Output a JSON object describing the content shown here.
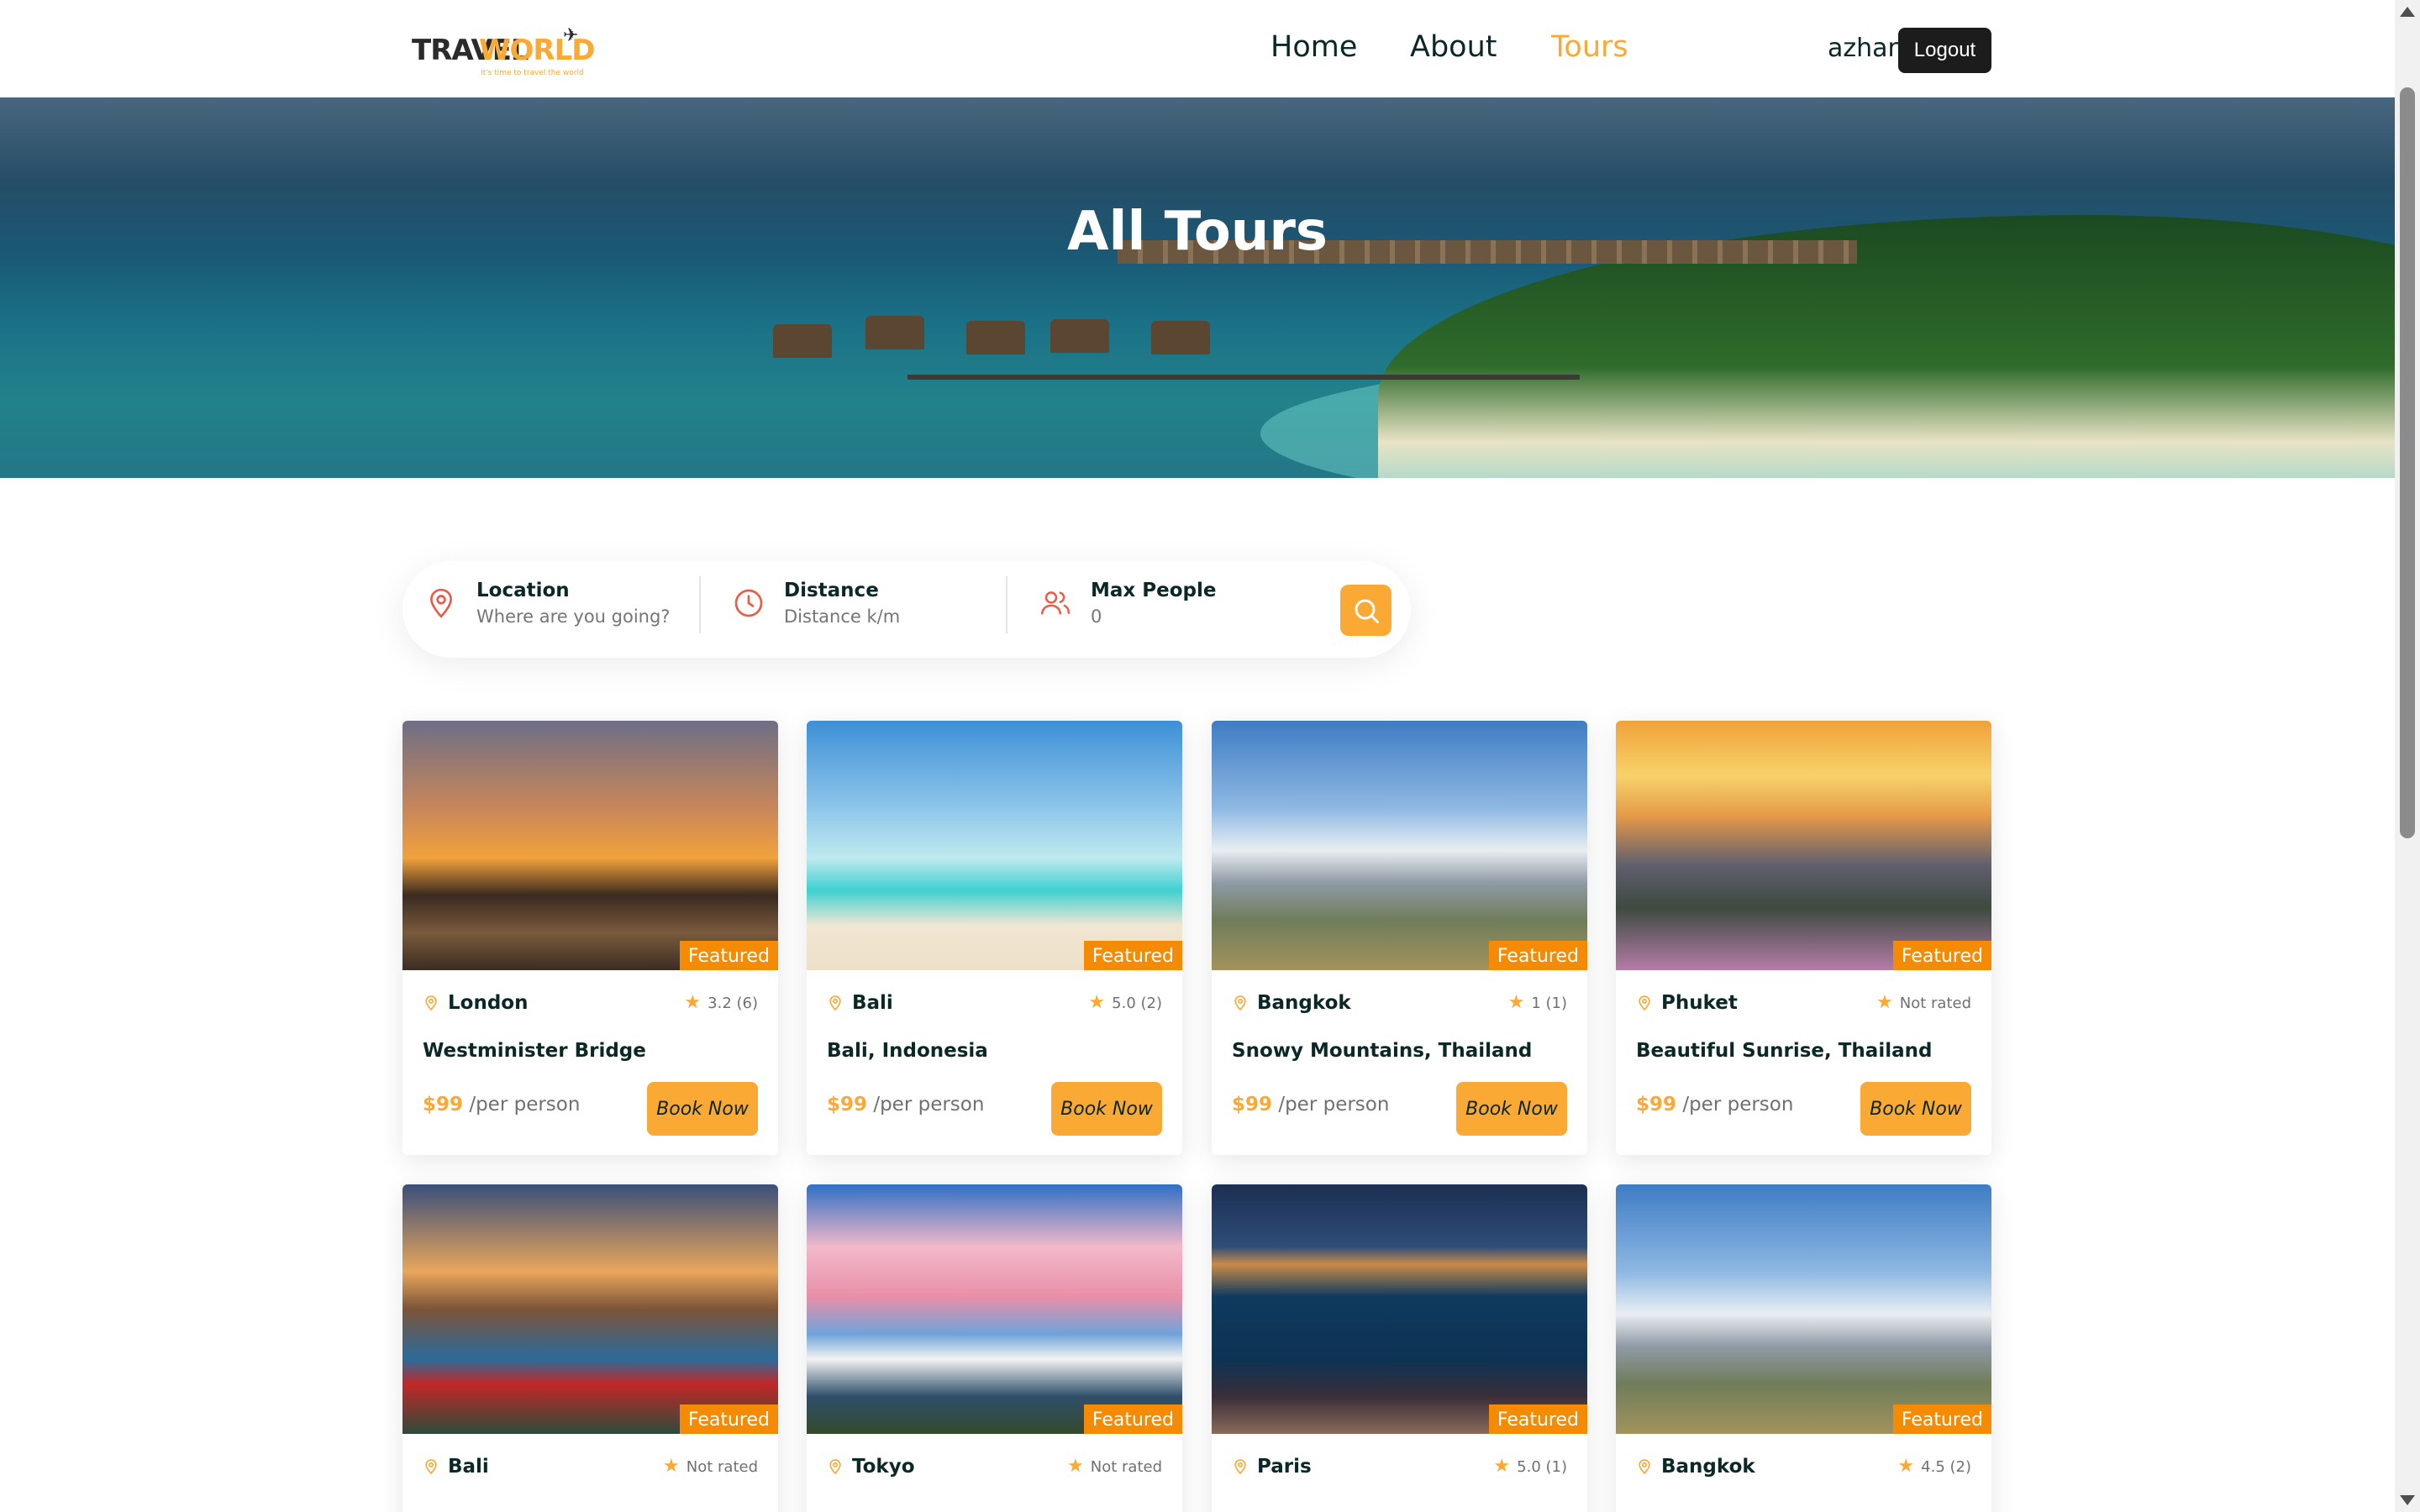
{
  "header": {
    "logo_word1": "TRAVEL",
    "logo_word2": "WORLD",
    "logo_tagline": "It's time to travel the world",
    "nav": [
      {
        "label": "Home",
        "active": false
      },
      {
        "label": "About",
        "active": false
      },
      {
        "label": "Tours",
        "active": true
      }
    ],
    "username": "azhar",
    "logout_label": "Logout"
  },
  "hero": {
    "title": "All Tours"
  },
  "search": {
    "location_label": "Location",
    "location_placeholder": "Where are you going?",
    "distance_label": "Distance",
    "distance_placeholder": "Distance k/m",
    "people_label": "Max People",
    "people_placeholder": "0",
    "location_icon": "map-pin-icon",
    "distance_icon": "clock-icon",
    "people_icon": "users-icon",
    "button_icon": "search-icon"
  },
  "tours": [
    {
      "city": "London",
      "rating": "3.2 (6)",
      "title": "Westminister Bridge",
      "price": "$99",
      "per": "/per person",
      "badge": "Featured",
      "book": "Book Now",
      "scene": "sunset-city"
    },
    {
      "city": "Bali",
      "rating": "5.0 (2)",
      "title": "Bali, Indonesia",
      "price": "$99",
      "per": "/per person",
      "badge": "Featured",
      "book": "Book Now",
      "scene": "beach"
    },
    {
      "city": "Bangkok",
      "rating": "1 (1)",
      "title": "Snowy Mountains, Thailand",
      "price": "$99",
      "per": "/per person",
      "badge": "Featured",
      "book": "Book Now",
      "scene": "mountain"
    },
    {
      "city": "Phuket",
      "rating": "Not rated",
      "title": "Beautiful Sunrise, Thailand",
      "price": "$99",
      "per": "/per person",
      "badge": "Featured",
      "book": "Book Now",
      "scene": "sunrise"
    },
    {
      "city": "Bali",
      "rating": "Not rated",
      "title": "",
      "price": "",
      "per": "",
      "badge": "Featured",
      "book": "",
      "scene": "cliff"
    },
    {
      "city": "Tokyo",
      "rating": "Not rated",
      "title": "",
      "price": "",
      "per": "",
      "badge": "Featured",
      "book": "",
      "scene": "blossom"
    },
    {
      "city": "Paris",
      "rating": "5.0 (1)",
      "title": "",
      "price": "",
      "per": "",
      "badge": "Featured",
      "book": "",
      "scene": "night-city"
    },
    {
      "city": "Bangkok",
      "rating": "4.5 (2)",
      "title": "",
      "price": "",
      "per": "",
      "badge": "Featured",
      "book": "",
      "scene": "mountain"
    }
  ],
  "colors": {
    "accent": "#faa935",
    "badge": "#f58b05",
    "heading": "#0b2727",
    "text_muted": "#6e7074",
    "logout_bg": "#1c1c1c"
  }
}
